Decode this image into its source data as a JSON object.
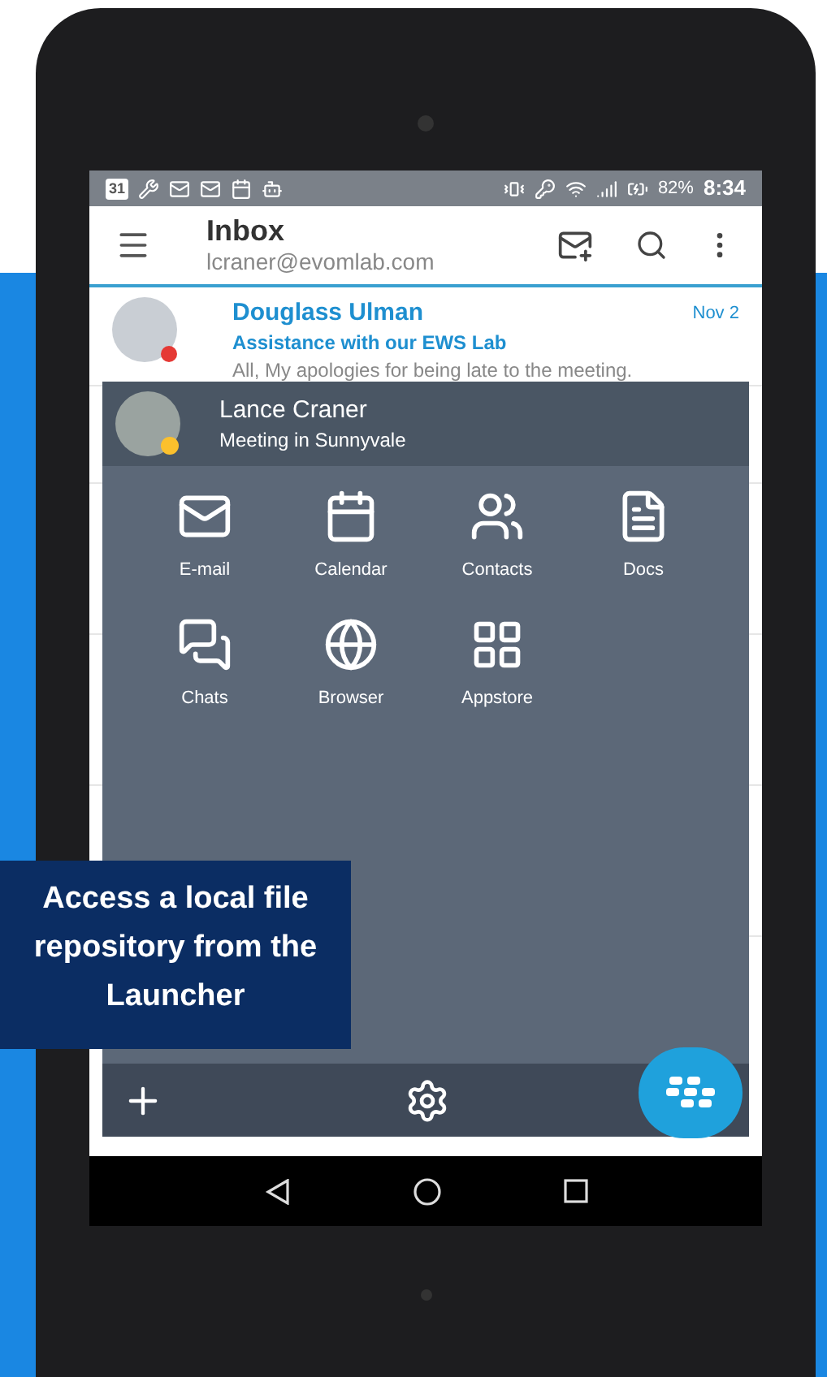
{
  "status_bar": {
    "calendar_day": "31",
    "battery": "82%",
    "time": "8:34"
  },
  "app_bar": {
    "title": "Inbox",
    "account": "lcraner@evomlab.com"
  },
  "messages": [
    {
      "sender": "Douglass Ulman",
      "subject": "Assistance with our EWS Lab",
      "lines": [
        "All, My apologies for being late to the meeting."
      ],
      "date": "Nov 2",
      "color": "#e53935"
    }
  ],
  "launcher": {
    "user": {
      "name": "Lance Craner",
      "status": "Meeting in Sunnyvale",
      "color": "#fbc02d"
    },
    "apps": [
      {
        "label": "E-mail"
      },
      {
        "label": "Calendar"
      },
      {
        "label": "Contacts"
      },
      {
        "label": "Docs"
      },
      {
        "label": "Chats"
      },
      {
        "label": "Browser"
      },
      {
        "label": "Appstore"
      }
    ]
  },
  "caption": "Access a local file repository from the Launcher"
}
